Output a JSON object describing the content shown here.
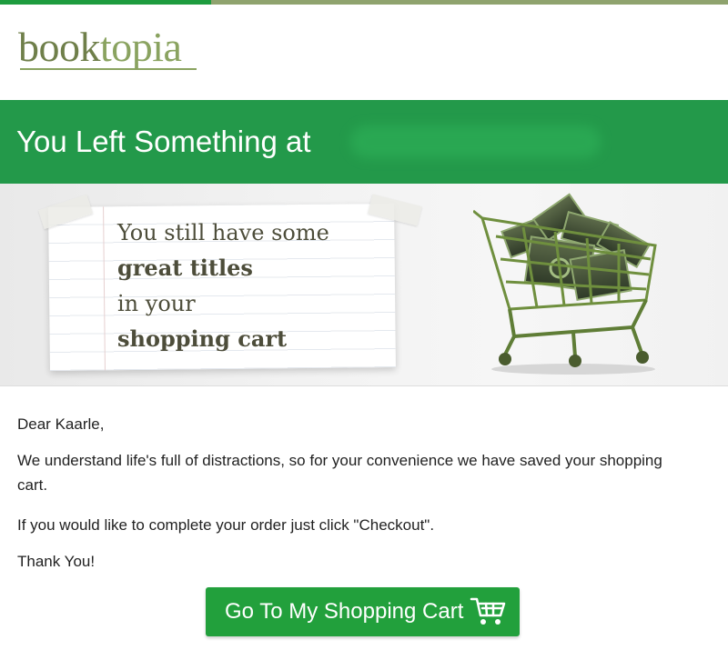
{
  "colors": {
    "brand_green": "#23994a",
    "stripe_dark": "#1e9c3f",
    "stripe_light": "#8fa36e",
    "logo_book": "#6f7f4a",
    "logo_topia": "#8aa360",
    "button_green": "#22a03c"
  },
  "logo": {
    "part1": "book",
    "part2": "topia"
  },
  "banner": {
    "title": "You Left Something at"
  },
  "hero": {
    "lines": [
      "You still have some",
      "great titles",
      "in your",
      "shopping cart"
    ],
    "image": "shopping-cart-with-books"
  },
  "body": {
    "greeting": "Dear Kaarle,",
    "paragraph1": "We understand life's full of distractions, so for your convenience we have saved your shopping cart.",
    "paragraph2": "If you would like to complete your order just click \"Checkout\".",
    "closing": "Thank You!"
  },
  "cta": {
    "label": "Go To My Shopping Cart",
    "icon": "cart-icon"
  }
}
